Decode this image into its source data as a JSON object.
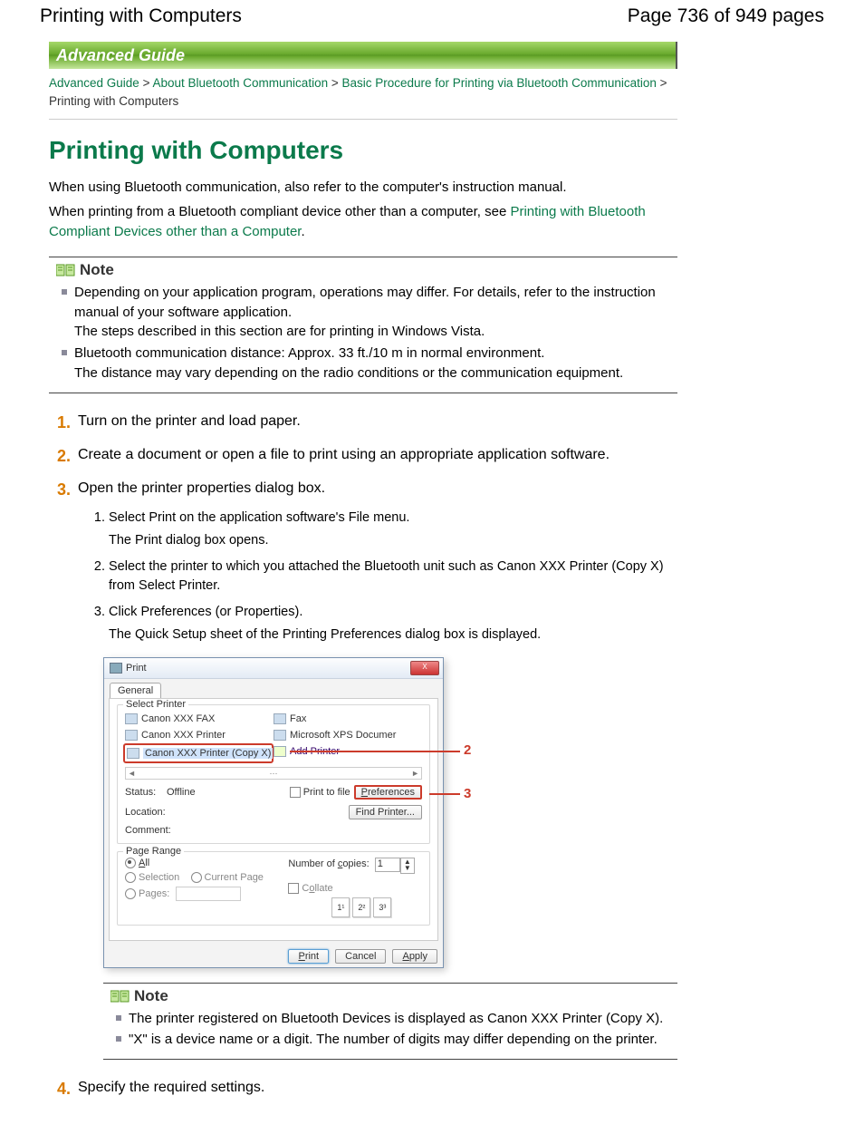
{
  "header": {
    "left": "Printing with Computers",
    "right": "Page 736 of 949 pages"
  },
  "banner": "Advanced Guide",
  "breadcrumb": {
    "a1": "Advanced Guide",
    "s1": " > ",
    "a2": "About Bluetooth Communication",
    "s2": " > ",
    "a3": "Basic Procedure for Printing via Bluetooth Communication",
    "s3": " > ",
    "tail": "Printing with Computers"
  },
  "title": "Printing with Computers",
  "intro1": "When using Bluetooth communication, also refer to the computer's instruction manual.",
  "intro2a": "When printing from a Bluetooth compliant device other than a computer, see ",
  "intro2link": "Printing with Bluetooth Compliant Devices other than a Computer",
  "intro2b": ".",
  "noteLabel": "Note",
  "note1": {
    "li1a": "Depending on your application program, operations may differ. For details, refer to the instruction manual of your software application.",
    "li1b": "The steps described in this section are for printing in Windows Vista.",
    "li2a": "Bluetooth communication distance: Approx. 33 ft./10 m in normal environment.",
    "li2b": "The distance may vary depending on the radio conditions or the communication equipment."
  },
  "steps": {
    "n1": "1.",
    "t1": "Turn on the printer and load paper.",
    "n2": "2.",
    "t2": "Create a document or open a file to print using an appropriate application software.",
    "n3": "3.",
    "t3": "Open the printer properties dialog box.",
    "n4": "4.",
    "t4": "Specify the required settings."
  },
  "sub": {
    "s1a": "Select Print on the application software's File menu.",
    "s1b": "The Print dialog box opens.",
    "s2": "Select the printer to which you attached the Bluetooth unit such as Canon XXX Printer (Copy X) from Select Printer.",
    "s3a": "Click Preferences (or Properties).",
    "s3b": "The Quick Setup sheet of the Printing Preferences dialog box is displayed."
  },
  "dialog": {
    "title": "Print",
    "close": "X",
    "tab": "General",
    "groupSelect": "Select Printer",
    "printers": {
      "p1": "Canon XXX FAX",
      "p2": "Canon XXX Printer",
      "p3": "Canon XXX Printer (Copy X)",
      "p4": "Fax",
      "p5": "Microsoft XPS Documer",
      "p6": "Add Printer"
    },
    "scrollMid": "···",
    "statusLbl": "Status:",
    "statusVal": "Offline",
    "locationLbl": "Location:",
    "commentLbl": "Comment:",
    "printToFile": "Print to file",
    "prefBtn_pre": "P",
    "prefBtn_rest": "references",
    "findBtn": "Find Printer...",
    "groupRange": "Page Range",
    "optAll_pre": "A",
    "optAll_rest": "ll",
    "optSel": "Selection",
    "optCur": "Current Page",
    "optPages": "Pages:",
    "copiesLbl_pre": "Number of ",
    "copiesLbl_u": "c",
    "copiesLbl_rest": "opies:",
    "copiesVal": "1",
    "collate_pre": "C",
    "collate_u": "o",
    "collate_rest": "llate",
    "c11": "1¹",
    "c22": "2²",
    "c33": "3³",
    "btnPrint_pre": "P",
    "btnPrint_rest": "rint",
    "btnCancel": "Cancel",
    "btnApply_pre": "A",
    "btnApply_rest": "pply"
  },
  "callouts": {
    "c2": "2",
    "c3": "3"
  },
  "note2": {
    "li1": "The printer registered on Bluetooth Devices is displayed as Canon XXX Printer (Copy X).",
    "li2": "\"X\" is a device name or a digit. The number of digits may differ depending on the printer."
  }
}
